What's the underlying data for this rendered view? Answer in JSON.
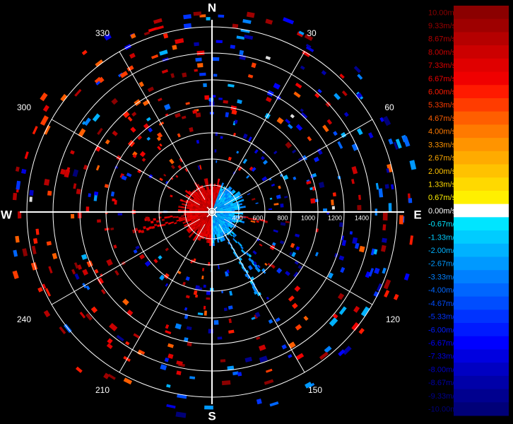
{
  "display": {
    "cardinals": {
      "north": "N",
      "south": "S",
      "east": "E",
      "west": "W"
    },
    "bearing_labels": [
      "330",
      "30",
      "300",
      "60",
      "240",
      "120",
      "210",
      "150"
    ],
    "range_labels": [
      "400",
      "600",
      "800",
      "1000",
      "1200",
      "1400"
    ]
  },
  "color_scale": {
    "entries": [
      {
        "label": "10.00m/s",
        "color": "#8b0000"
      },
      {
        "label": "9.33m/s",
        "color": "#9e0000"
      },
      {
        "label": "8.67m/s",
        "color": "#b50000"
      },
      {
        "label": "8.00m/s",
        "color": "#cc0000"
      },
      {
        "label": "7.33m/s",
        "color": "#e00000"
      },
      {
        "label": "6.67m/s",
        "color": "#f00000"
      },
      {
        "label": "6.00m/s",
        "color": "#ff1a00"
      },
      {
        "label": "5.33m/s",
        "color": "#ff3c00"
      },
      {
        "label": "4.67m/s",
        "color": "#ff5e00"
      },
      {
        "label": "4.00m/s",
        "color": "#ff7a00"
      },
      {
        "label": "3.33m/s",
        "color": "#ff9400"
      },
      {
        "label": "2.67m/s",
        "color": "#ffab00"
      },
      {
        "label": "2.00m/s",
        "color": "#ffc200"
      },
      {
        "label": "1.33m/s",
        "color": "#ffd900"
      },
      {
        "label": "0.67m/s",
        "color": "#fff000"
      },
      {
        "label": "0.00m/s",
        "color": "#ffffff"
      },
      {
        "label": "-0.67m/s",
        "color": "#00e5ff"
      },
      {
        "label": "-1.33m/s",
        "color": "#00ccff"
      },
      {
        "label": "-2.00m/s",
        "color": "#00b2ff"
      },
      {
        "label": "-2.67m/s",
        "color": "#0099ff"
      },
      {
        "label": "-3.33m/s",
        "color": "#0080ff"
      },
      {
        "label": "-4.00m/s",
        "color": "#0066ff"
      },
      {
        "label": "-4.67m/s",
        "color": "#004dff"
      },
      {
        "label": "-5.33m/s",
        "color": "#0033ff"
      },
      {
        "label": "-6.00m/s",
        "color": "#001aff"
      },
      {
        "label": "-6.67m/s",
        "color": "#0000ff"
      },
      {
        "label": "-7.33m/s",
        "color": "#0000e0"
      },
      {
        "label": "-8.00m/s",
        "color": "#0000c2"
      },
      {
        "label": "-8.67m/s",
        "color": "#0000a8"
      },
      {
        "label": "-9.33m/s",
        "color": "#00008f"
      },
      {
        "label": "-10.00m/s",
        "color": "#000078"
      }
    ]
  }
}
